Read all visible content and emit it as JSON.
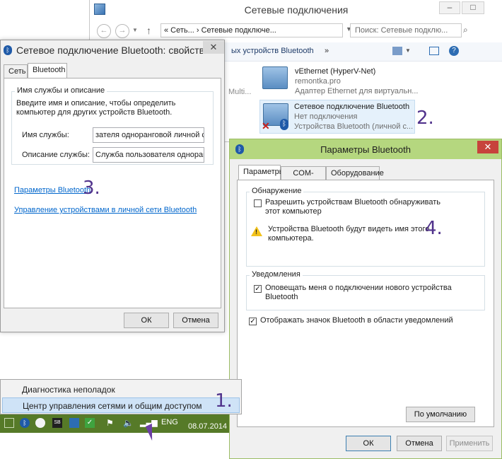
{
  "explorer": {
    "title": "Сетевые подключения",
    "address": "«  Сеть...  ›  Сетевые подключе...",
    "search_placeholder": "Поиск: Сетевые подклю...",
    "cmdbar_text": "ых устройств Bluetooth",
    "left_fragment": "Multi...",
    "connections": [
      {
        "name": "vEthernet (HyperV-Net)",
        "line2": "remontka.pro",
        "line3": "Адаптер Ethernet для виртуальн..."
      },
      {
        "name": "Сетевое подключение Bluetooth",
        "line2": "Нет подключения",
        "line3": "Устройства Bluetooth (личной с..."
      }
    ],
    "step_label": "2."
  },
  "props": {
    "title": "Сетевое подключение Bluetooth: свойства",
    "tabs": [
      "Сеть",
      "Bluetooth"
    ],
    "group_label": "Имя службы и описание",
    "description": "Введите имя и описание, чтобы определить компьютер для других устройств Bluetooth.",
    "service_name_label": "Имя службы:",
    "service_name_value": "зателя одноранговой личной сети",
    "service_desc_label": "Описание службы:",
    "service_desc_value": "Служба пользователя одноранговой",
    "link_params": "Параметры Bluetooth",
    "step_label": "3.",
    "link_manage": "Управление устройствами в личной сети Bluetooth",
    "ok": "ОК",
    "cancel": "Отмена"
  },
  "bt": {
    "title": "Параметры Bluetooth",
    "tabs": [
      "Параметры",
      "COM-порты",
      "Оборудование"
    ],
    "discovery_label": "Обнаружение",
    "allow_discovery": "Разрешить устройствам Bluetooth обнаруживать этот компьютер",
    "warning": "Устройства Bluetooth будут видеть имя этого компьютера.",
    "step_label": "4.",
    "notifications_label": "Уведомления",
    "notify_new": "Оповещать меня о подключении нового устройства Bluetooth",
    "show_icon": "Отображать значок Bluetooth в области уведомлений",
    "defaults": "По умолчанию",
    "ok": "ОК",
    "cancel": "Отмена",
    "apply": "Применить"
  },
  "tray_menu": {
    "items": [
      "Диагностика неполадок",
      "Центр управления сетями и общим доступом"
    ],
    "step_label": "1."
  },
  "taskbar": {
    "lang": "ENG",
    "date": "08.07.2014"
  }
}
